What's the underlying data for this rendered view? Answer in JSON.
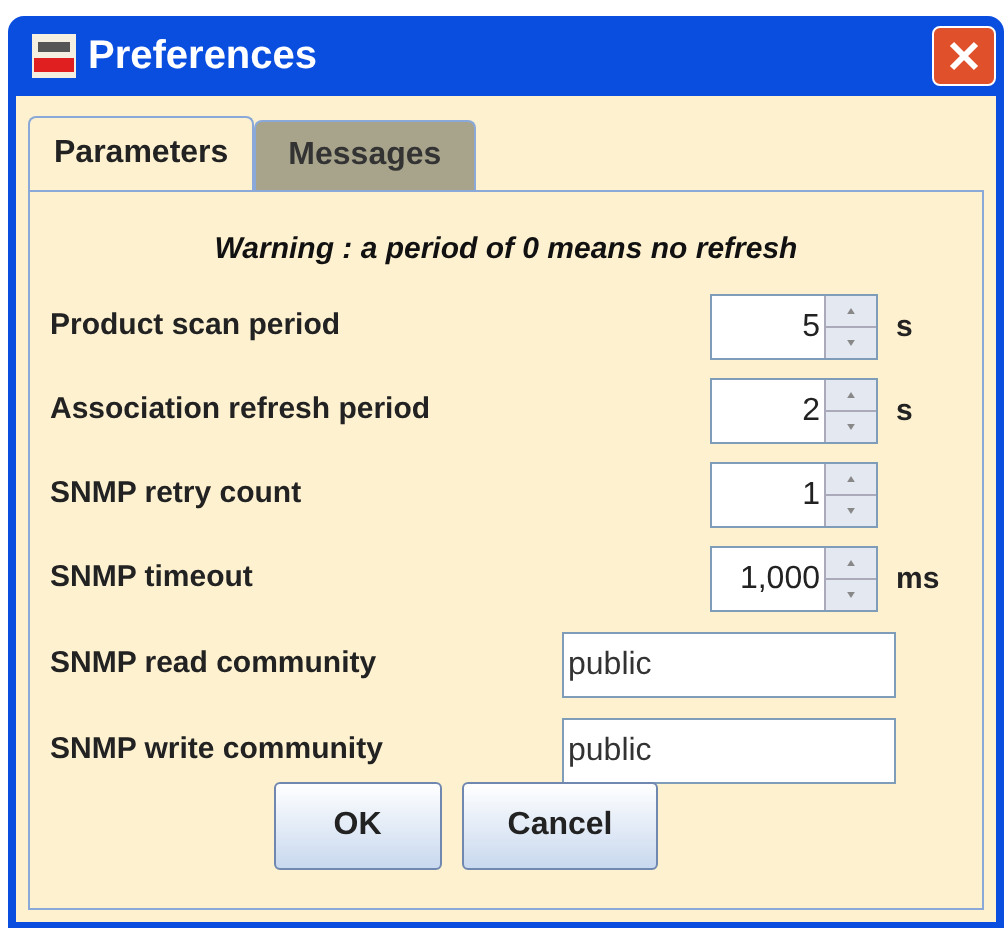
{
  "window": {
    "title": "Preferences"
  },
  "tabs": [
    {
      "label": "Parameters",
      "selected": true
    },
    {
      "label": "Messages",
      "selected": false
    }
  ],
  "warning": "Warning : a period of 0 means no refresh",
  "fields": [
    {
      "kind": "spinner",
      "label": "Product scan period",
      "value": "5",
      "unit": "s"
    },
    {
      "kind": "spinner",
      "label": "Association refresh period",
      "value": "2",
      "unit": "s"
    },
    {
      "kind": "spinner",
      "label": "SNMP retry count",
      "value": "1"
    },
    {
      "kind": "spinner",
      "label": "SNMP timeout",
      "value": "1,000",
      "unit": "ms"
    },
    {
      "kind": "text",
      "label": "SNMP read community",
      "value": "public"
    },
    {
      "kind": "text",
      "label": "SNMP write community",
      "value": "public"
    }
  ],
  "buttons": [
    "OK",
    "Cancel"
  ]
}
